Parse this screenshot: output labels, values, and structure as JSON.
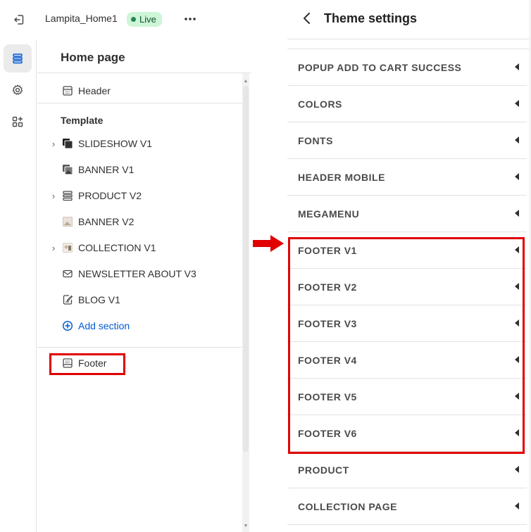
{
  "topbar": {
    "exit_icon": "exit-icon",
    "store_name": "Lampita_Home1",
    "status_badge": "Live",
    "more_icon": "more-horizontal-icon"
  },
  "rail": {
    "items": [
      {
        "icon": "sections-icon",
        "active": true
      },
      {
        "icon": "settings-gear-icon",
        "active": false
      },
      {
        "icon": "apps-add-icon",
        "active": false
      }
    ]
  },
  "sidebar": {
    "title": "Home page",
    "header_item": "Header",
    "template_heading": "Template",
    "template_sections": [
      {
        "label": "SLIDESHOW V1",
        "icon": "slideshow-icon",
        "expandable": true
      },
      {
        "label": "BANNER V1",
        "icon": "image-thumb-icon",
        "expandable": false
      },
      {
        "label": "PRODUCT V2",
        "icon": "product-list-icon",
        "expandable": true
      },
      {
        "label": "BANNER V2",
        "icon": "image-thumb-icon",
        "expandable": false
      },
      {
        "label": "COLLECTION V1",
        "icon": "collection-thumb-icon",
        "expandable": true
      },
      {
        "label": "NEWSLETTER ABOUT V3",
        "icon": "email-icon",
        "expandable": false
      },
      {
        "label": "BLOG V1",
        "icon": "blog-icon",
        "expandable": false
      }
    ],
    "add_section": "Add section",
    "footer_item": "Footer"
  },
  "theme_settings": {
    "title": "Theme settings",
    "items": [
      "POPUP ADD TO CART SUCCESS",
      "COLORS",
      "FONTS",
      "HEADER MOBILE",
      "MEGAMENU",
      "FOOTER V1",
      "FOOTER V2",
      "FOOTER V3",
      "FOOTER V4",
      "FOOTER V5",
      "FOOTER V6",
      "PRODUCT",
      "COLLECTION PAGE"
    ]
  },
  "colors": {
    "highlight": "#e00000",
    "link": "#005bd3",
    "live_badge_bg": "#cdf5d6"
  }
}
